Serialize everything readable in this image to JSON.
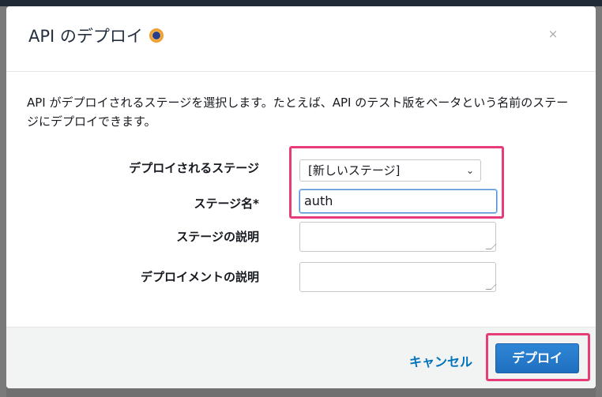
{
  "dialog": {
    "title": "API のデプロイ",
    "close_glyph": "×",
    "description": "API がデプロイされるステージを選択します。たとえば、API のテスト版をベータという名前のステージにデプロイできます。"
  },
  "form": {
    "stage_label": "デプロイされるステージ",
    "stage_selected": "[新しいステージ]",
    "stage_name_label": "ステージ名*",
    "stage_name_value": "auth",
    "stage_desc_label": "ステージの説明",
    "stage_desc_value": "",
    "deploy_desc_label": "デプロイメントの説明",
    "deploy_desc_value": ""
  },
  "footer": {
    "cancel_label": "キャンセル",
    "deploy_label": "デプロイ"
  },
  "colors": {
    "primary": "#1f6fc0",
    "link": "#0073bb",
    "highlight": "#e63c7a"
  }
}
